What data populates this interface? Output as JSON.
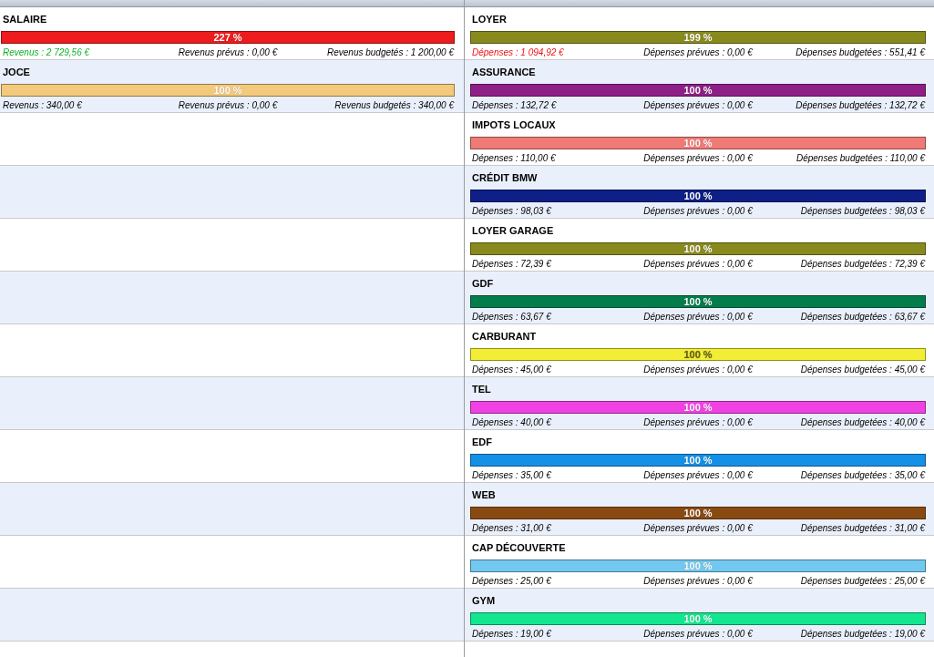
{
  "columns": [
    {
      "kind": "income",
      "items": [
        {
          "name": "SALAIRE",
          "color": "#ee1c1c",
          "level": 1,
          "percent": "227 %",
          "over_budget": true,
          "actual": "Revenus : 2 729,56 €",
          "planned": "Revenus prévus : 0,00 €",
          "budgeted": "Revenus budgetés : 1 200,00 €"
        },
        {
          "name": "JOCE",
          "color": "#f3c97c",
          "level": 1,
          "percent": "100 %",
          "over_budget": false,
          "actual": "Revenus : 340,00 €",
          "planned": "Revenus prévus : 0,00 €",
          "budgeted": "Revenus budgetés : 340,00 €"
        }
      ]
    },
    {
      "kind": "expense",
      "items": [
        {
          "name": "LOYER",
          "color": "#898a1e",
          "level": 1,
          "percent": "199 %",
          "over_budget": true,
          "actual": "Dépenses : 1 094,92 €",
          "planned": "Dépenses prévues : 0,00 €",
          "budgeted": "Dépenses budgetées : 551,41 €"
        },
        {
          "name": "ASSURANCE",
          "color": "#8e1f86",
          "level": 1,
          "percent": "100 %",
          "over_budget": false,
          "actual": "Dépenses : 132,72 €",
          "planned": "Dépenses prévues : 0,00 €",
          "budgeted": "Dépenses budgetées : 132,72 €"
        },
        {
          "name": "IMPOTS LOCAUX",
          "color": "#f07a76",
          "level": 1,
          "percent": "100 %",
          "over_budget": false,
          "actual": "Dépenses : 110,00 €",
          "planned": "Dépenses prévues : 0,00 €",
          "budgeted": "Dépenses budgetées : 110,00 €"
        },
        {
          "name": "CRÉDIT BMW",
          "color": "#0e1f88",
          "level": 1,
          "percent": "100 %",
          "over_budget": false,
          "actual": "Dépenses : 98,03 €",
          "planned": "Dépenses prévues : 0,00 €",
          "budgeted": "Dépenses budgetées : 98,03 €"
        },
        {
          "name": "LOYER GARAGE",
          "color": "#898a1e",
          "level": 1,
          "percent": "100 %",
          "over_budget": false,
          "actual": "Dépenses : 72,39 €",
          "planned": "Dépenses prévues : 0,00 €",
          "budgeted": "Dépenses budgetées : 72,39 €"
        },
        {
          "name": "GDF",
          "color": "#037c4c",
          "level": 1,
          "percent": "100 %",
          "over_budget": false,
          "actual": "Dépenses : 63,67 €",
          "planned": "Dépenses prévues : 0,00 €",
          "budgeted": "Dépenses budgetées : 63,67 €"
        },
        {
          "name": "CARBURANT",
          "color": "#f2ee36",
          "level": 1,
          "percent": "100 %",
          "over_budget": false,
          "actual": "Dépenses : 45,00 €",
          "planned": "Dépenses prévues : 0,00 €",
          "budgeted": "Dépenses budgetées : 45,00 €"
        },
        {
          "name": "TEL",
          "color": "#f042e2",
          "level": 1,
          "percent": "100 %",
          "over_budget": false,
          "actual": "Dépenses : 40,00 €",
          "planned": "Dépenses prévues : 0,00 €",
          "budgeted": "Dépenses budgetées : 40,00 €"
        },
        {
          "name": "EDF",
          "color": "#1490e6",
          "level": 1,
          "percent": "100 %",
          "over_budget": false,
          "actual": "Dépenses : 35,00 €",
          "planned": "Dépenses prévues : 0,00 €",
          "budgeted": "Dépenses budgetées : 35,00 €"
        },
        {
          "name": "WEB",
          "color": "#894a12",
          "level": 1,
          "percent": "100 %",
          "over_budget": false,
          "actual": "Dépenses : 31,00 €",
          "planned": "Dépenses prévues : 0,00 €",
          "budgeted": "Dépenses budgetées : 31,00 €"
        },
        {
          "name": "CAP DÉCOUVERTE",
          "color": "#72c8ee",
          "level": 1,
          "percent": "100 %",
          "over_budget": false,
          "actual": "Dépenses : 25,00 €",
          "planned": "Dépenses prévues : 0,00 €",
          "budgeted": "Dépenses budgetées : 25,00 €"
        },
        {
          "name": "GYM",
          "color": "#12e68e",
          "level": 1,
          "percent": "100 %",
          "over_budget": false,
          "actual": "Dépenses : 19,00 €",
          "planned": "Dépenses prévues : 0,00 €",
          "budgeted": "Dépenses budgetées : 19,00 €"
        }
      ]
    }
  ]
}
